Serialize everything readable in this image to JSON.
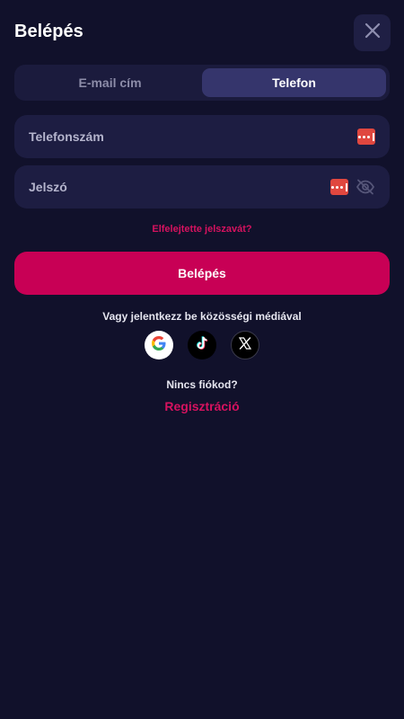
{
  "header": {
    "title": "Belépés"
  },
  "tabs": [
    {
      "label": "E-mail cím",
      "active": false
    },
    {
      "label": "Telefon",
      "active": true
    }
  ],
  "form": {
    "phone": {
      "placeholder": "Telefonszám",
      "value": ""
    },
    "password": {
      "placeholder": "Jelszó",
      "value": ""
    },
    "forgot_password": "Elfelejtette jelszavát?",
    "submit_label": "Belépés"
  },
  "social": {
    "prompt": "Vagy jelentkezz be közösségi médiával",
    "providers": [
      "google-icon",
      "tiktok-icon",
      "x-icon"
    ]
  },
  "footer": {
    "no_account": "Nincs fiókod?",
    "register_label": "Regisztráció"
  },
  "colors": {
    "background": "#11112b",
    "accent": "#c80055",
    "accent_text": "#d6125f",
    "field": "#1d1d42",
    "tab_active": "#35356c"
  }
}
